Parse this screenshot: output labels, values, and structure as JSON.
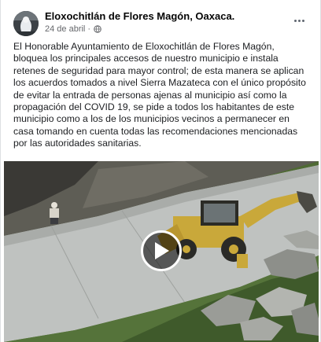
{
  "post": {
    "page_name": "Eloxochitlán de Flores Magón, Oaxaca.",
    "date": "24 de abril",
    "separator": "·",
    "privacy_icon": "globe-icon",
    "more_icon": "more-options-icon",
    "text": "El Honorable Ayuntamiento de Eloxochitlán de Flores Magón, bloquea los principales accesos de nuestro municipio e instala retenes de seguridad para mayor control; de esta manera se aplican los acuerdos tomados a nivel Sierra Mazateca con el único propósito de evitar la entrada de personas ajenas al municipio así como la propagación del COVID 19, se pide a todos los habitantes de este municipio como a los de los municipios vecinos a permanecer en casa tomando en cuenta todas las recomendaciones mencionadas por las autoridades sanitarias."
  },
  "media": {
    "type": "video",
    "overlay_icon": "play-icon",
    "colors": {
      "concrete": "#bfc2c0",
      "excavator": "#c9a83a",
      "grass": "#4f6a34"
    }
  }
}
